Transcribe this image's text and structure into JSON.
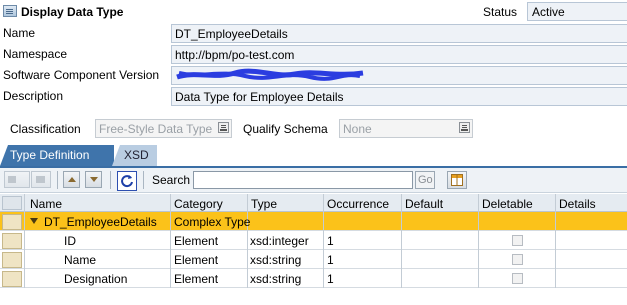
{
  "header": {
    "title": "Display Data Type",
    "status_label": "Status",
    "status_value": "Active"
  },
  "form": {
    "name_label": "Name",
    "name_value": "DT_EmployeeDetails",
    "namespace_label": "Namespace",
    "namespace_value": "http://bpm/po-test.com",
    "swcv_label": "Software Component Version",
    "description_label": "Description",
    "description_value": "Data Type for Employee Details"
  },
  "classification": {
    "label": "Classification",
    "value": "Free-Style Data Type",
    "qualify_label": "Qualify Schema",
    "qualify_value": "None"
  },
  "tabs": {
    "type_definition": "Type Definition",
    "xsd": "XSD"
  },
  "toolbar": {
    "search_label": "Search",
    "search_value": "",
    "go_label": "Go"
  },
  "table": {
    "columns": [
      "Name",
      "Category",
      "Type",
      "Occurrence",
      "Default",
      "Deletable",
      "Details"
    ],
    "rows": [
      {
        "name": "DT_EmployeeDetails",
        "category": "Complex Type",
        "type": "",
        "occurrence": "",
        "default": ""
      },
      {
        "name": "ID",
        "category": "Element",
        "type": "xsd:integer",
        "occurrence": "1",
        "default": ""
      },
      {
        "name": "Name",
        "category": "Element",
        "type": "xsd:string",
        "occurrence": "1",
        "default": ""
      },
      {
        "name": "Designation",
        "category": "Element",
        "type": "xsd:string",
        "occurrence": "1",
        "default": ""
      }
    ]
  },
  "colors": {
    "selected_row": "#fbc21a",
    "tab_active": "#3f74ab",
    "field_bg": "#eef2f7"
  }
}
